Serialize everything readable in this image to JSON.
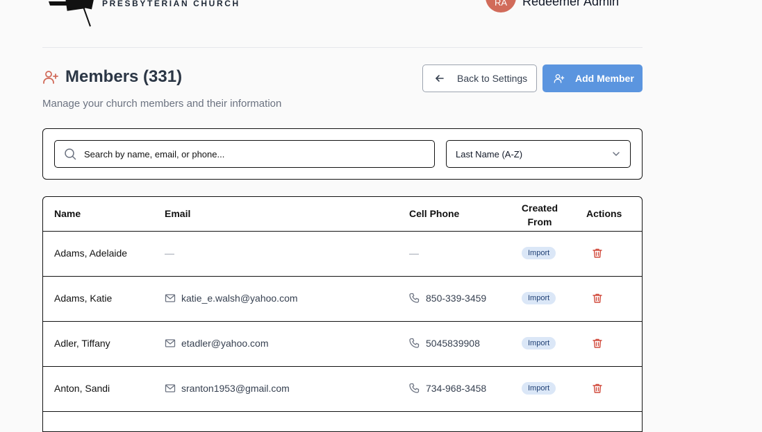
{
  "header": {
    "church_name": "PRESBYTERIAN CHURCH",
    "user_initials": "RA",
    "user_name": "Redeemer Admin"
  },
  "page": {
    "title": "Members (331)",
    "subtitle": "Manage your church members and their information",
    "back_label": "Back to Settings",
    "add_label": "Add Member"
  },
  "filters": {
    "search_placeholder": "Search by name, email, or phone...",
    "sort_value": "Last Name (A-Z)"
  },
  "table": {
    "headers": {
      "name": "Name",
      "email": "Email",
      "phone": "Cell Phone",
      "created_from": "Created From",
      "actions": "Actions"
    },
    "rows": [
      {
        "name": "Adams, Adelaide",
        "email": "—",
        "phone": "—",
        "created_from": "Import"
      },
      {
        "name": "Adams, Katie",
        "email": "katie_e.walsh@yahoo.com",
        "phone": "850-339-3459",
        "created_from": "Import"
      },
      {
        "name": "Adler, Tiffany",
        "email": "etadler@yahoo.com",
        "phone": "5045839908",
        "created_from": "Import"
      },
      {
        "name": "Anton, Sandi",
        "email": "sranton1953@gmail.com",
        "phone": "734-968-3458",
        "created_from": "Import"
      }
    ]
  },
  "colors": {
    "accent": "#5b95df",
    "danger": "#d14b3d",
    "badge_bg": "#dbe7f7"
  }
}
